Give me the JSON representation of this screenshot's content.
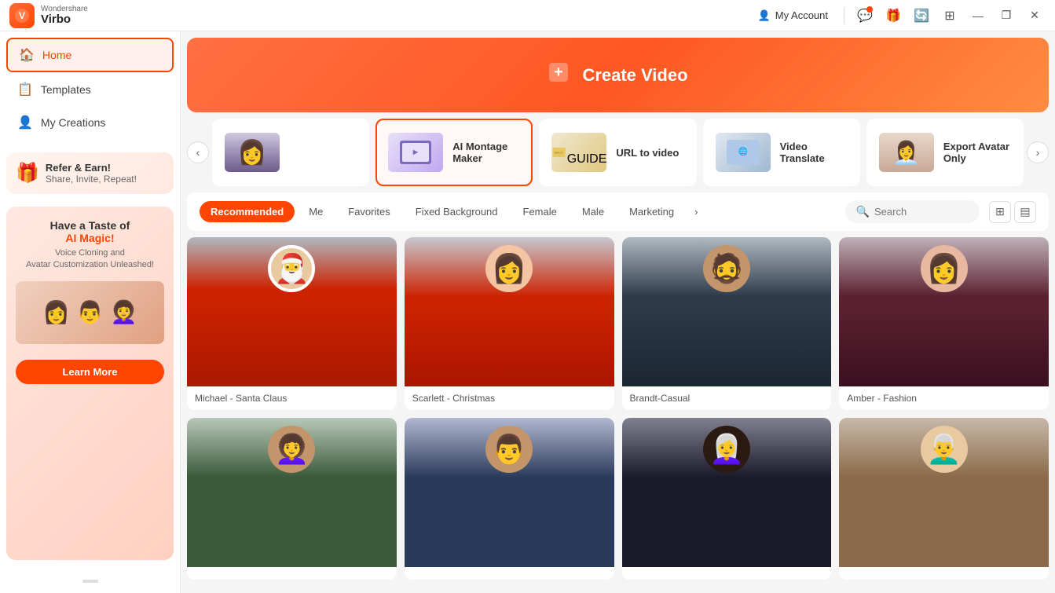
{
  "app": {
    "brand_top": "Wondershare",
    "brand_bottom": "Virbo",
    "logo_letter": "V"
  },
  "titlebar": {
    "my_account": "My Account",
    "win_minimize": "—",
    "win_maximize": "❐",
    "win_close": "✕"
  },
  "sidebar": {
    "nav_items": [
      {
        "id": "home",
        "label": "Home",
        "icon": "🏠",
        "active": true
      },
      {
        "id": "templates",
        "label": "Templates",
        "icon": "📋",
        "active": false
      },
      {
        "id": "my-creations",
        "label": "My Creations",
        "icon": "👤",
        "active": false
      }
    ],
    "promo": {
      "icon": "🎁",
      "title": "Refer & Earn!",
      "sub": "Share, Invite, Repeat!"
    },
    "ai_card": {
      "title": "Have a Taste of",
      "highlight": "AI Magic!",
      "sub": "Voice Cloning and\nAvatar Customization Unleashed!",
      "learn_more": "Learn More"
    }
  },
  "banner": {
    "icon": "➕",
    "label": "Create Video"
  },
  "feature_cards": [
    {
      "id": "first-card",
      "label": "",
      "active": false
    },
    {
      "id": "ai-montage",
      "title": "AI Montage\nMaker",
      "active": true
    },
    {
      "id": "url-to-video",
      "title": "URL to video",
      "active": false
    },
    {
      "id": "video-translate",
      "title": "Video\nTranslate",
      "active": false
    },
    {
      "id": "export-avatar",
      "title": "Export Avatar\nOnly",
      "active": false
    }
  ],
  "filters": {
    "tabs": [
      {
        "id": "recommended",
        "label": "Recommended",
        "active": true
      },
      {
        "id": "me",
        "label": "Me",
        "active": false
      },
      {
        "id": "favorites",
        "label": "Favorites",
        "active": false
      },
      {
        "id": "fixed-bg",
        "label": "Fixed Background",
        "active": false
      },
      {
        "id": "female",
        "label": "Female",
        "active": false
      },
      {
        "id": "male",
        "label": "Male",
        "active": false
      },
      {
        "id": "marketing",
        "label": "Marketing",
        "active": false
      }
    ],
    "more_label": "›",
    "search_placeholder": "Search"
  },
  "avatars": [
    {
      "id": "michael-santa-claus",
      "name": "Michael - Santa Claus",
      "bg": "#cc3300",
      "skin": "#e8c9a0"
    },
    {
      "id": "scarlett-christmas",
      "name": "Scarlett - Christmas",
      "bg": "#cc2200",
      "skin": "#f5c5a3"
    },
    {
      "id": "brandt-casual",
      "name": "Brandt-Casual",
      "bg": "#2c3a4a",
      "skin": "#c4956a"
    },
    {
      "id": "amber-fashion",
      "name": "Amber - Fashion",
      "bg": "#4a1a28",
      "skin": "#e8b8a0"
    },
    {
      "id": "avatar-5",
      "name": "",
      "bg": "#3a5a3a",
      "skin": "#c4956a"
    },
    {
      "id": "avatar-6",
      "name": "",
      "bg": "#2a3a5a",
      "skin": "#c4956a"
    },
    {
      "id": "avatar-7",
      "name": "",
      "bg": "#1a1a2a",
      "skin": "#2a1a12"
    },
    {
      "id": "avatar-8",
      "name": "",
      "bg": "#8a6a4a",
      "skin": "#e8c9a0"
    }
  ]
}
